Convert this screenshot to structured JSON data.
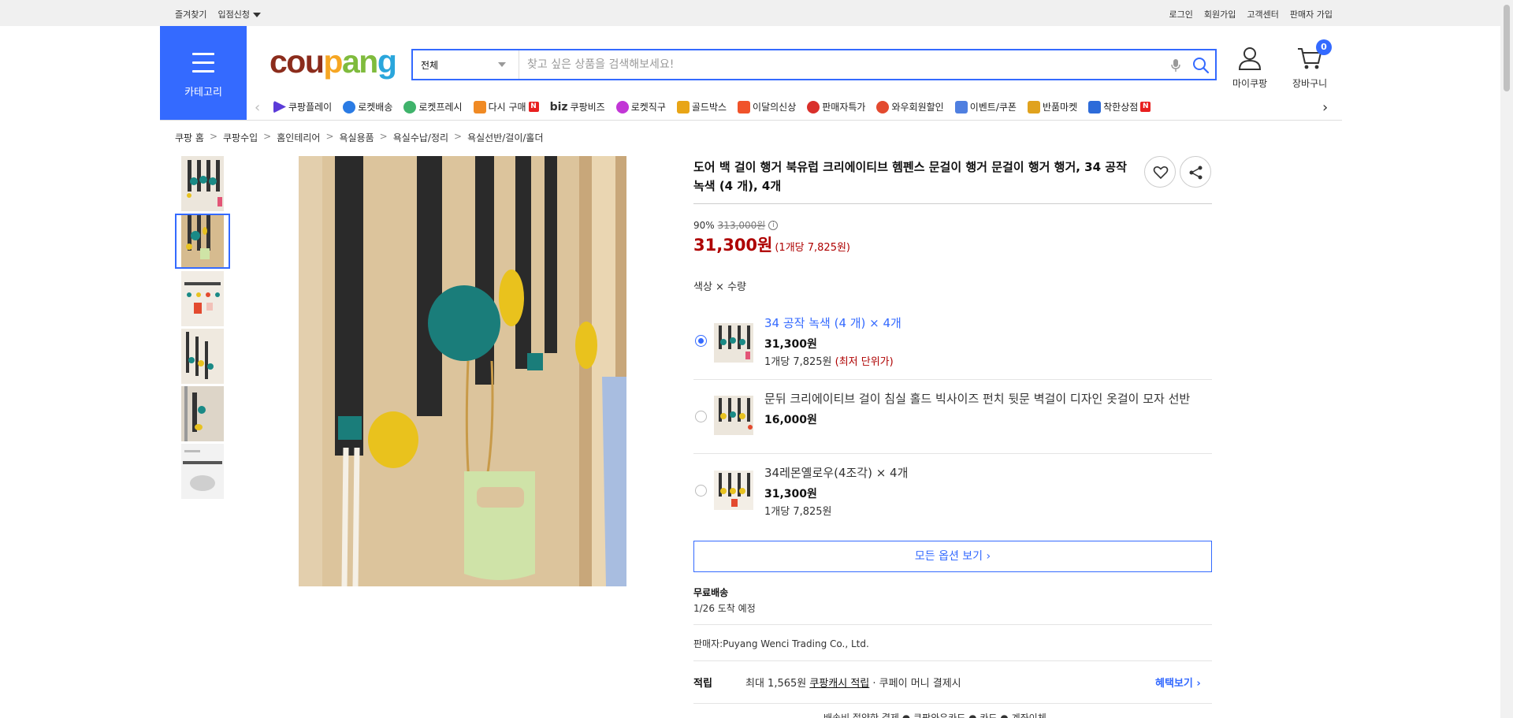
{
  "topbar": {
    "left": [
      "즐겨찾기",
      "입점신청"
    ],
    "right": [
      "로그인",
      "회원가입",
      "고객센터",
      "판매자 가입"
    ]
  },
  "category_button": {
    "label": "카테고리"
  },
  "logo": {
    "parts": [
      "cou",
      "p",
      "an",
      "g"
    ]
  },
  "search": {
    "category_value": "전체",
    "placeholder": "찾고 싶은 상품을 검색해보세요!"
  },
  "header_icons": {
    "mypage": "마이쿠팡",
    "cart": "장바구니",
    "cart_count": "0"
  },
  "nav": {
    "items": [
      {
        "label": "쿠팡플레이",
        "color": "#5b3bd8"
      },
      {
        "label": "로켓배송",
        "color": "#2a7be4"
      },
      {
        "label": "로켓프레시",
        "color": "#3fb36b"
      },
      {
        "label": "다시 구매",
        "color": "#f08a24",
        "badge": "N"
      },
      {
        "label": "쿠팡비즈",
        "prefix": "biz"
      },
      {
        "label": "로켓직구",
        "color": "#c236d6"
      },
      {
        "label": "골드박스",
        "color": "#e8a516"
      },
      {
        "label": "이달의신상",
        "color": "#f0532a"
      },
      {
        "label": "판매자특가",
        "color": "#d9302b"
      },
      {
        "label": "와우회원할인",
        "color": "#e34a2f"
      },
      {
        "label": "이벤트/쿠폰",
        "color": "#4f7fe0"
      },
      {
        "label": "반품마켓",
        "color": "#e0a21e"
      },
      {
        "label": "착한상점",
        "color": "#2d6bd9",
        "badge": "N"
      }
    ]
  },
  "breadcrumb": [
    "쿠팡 홈",
    "쿠팡수입",
    "홈인테리어",
    "욕실용품",
    "욕실수납/정리",
    "욕실선반/걸이/홀더"
  ],
  "product": {
    "title": "도어 백 걸이 행거 북유럽 크리에이티브 헴펜스 문걸이 행거 문걸이 행거 행거, 34 공작 녹색 (4 개), 4개",
    "discount": "90%",
    "original_price": "313,000원",
    "price": "31,300원",
    "unit_price": "(1개당 7,825원)"
  },
  "options": {
    "heading": "색상 × 수량",
    "items": [
      {
        "name": "34 공작 녹색 (4 개) × 4개",
        "price": "31,300원",
        "per": "1개당 7,825원",
        "lowest": "(최저 단위가)",
        "selected": true
      },
      {
        "name": "문뒤 크리에이티브 걸이 침실 홀드 빅사이즈 펀치 뒷문 벽걸이 디자인 옷걸이 모자 선반",
        "price": "16,000원",
        "selected": false
      },
      {
        "name": "34레몬옐로우(4조각) × 4개",
        "price": "31,300원",
        "per": "1개당 7,825원",
        "selected": false
      }
    ],
    "all_button": "모든 옵션 보기 ›"
  },
  "shipping": {
    "title": "무료배송",
    "date": "1/26 도착 예정"
  },
  "seller": "판매자:Puyang Wenci Trading Co., Ltd.",
  "reward": {
    "label": "적립",
    "prefix": "최대 1,565원 ",
    "link": "쿠팡캐시 적립",
    "suffix": " · 쿠페이 머니 결제시",
    "benefit": "혜택보기 ›"
  },
  "bottom_partial": "배송비 절약한 결제 ● 쿠팡와우카드  ● 카드  ● 계좌이체"
}
